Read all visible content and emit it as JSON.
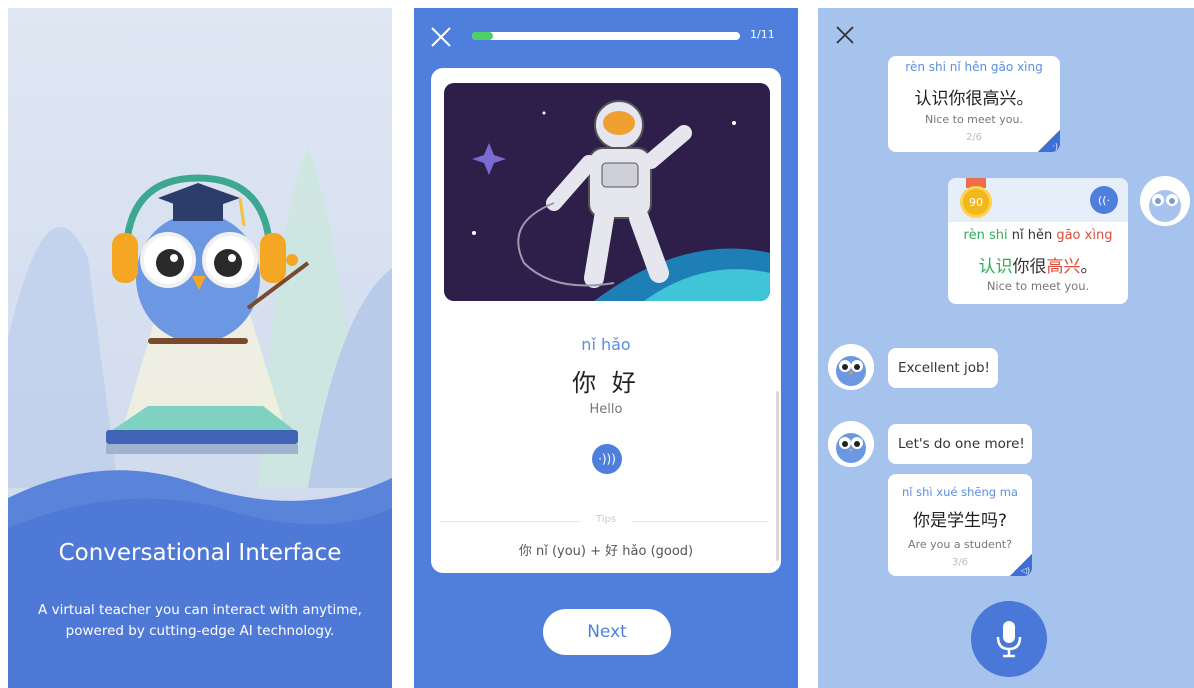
{
  "intro": {
    "title": "Conversational Interface",
    "description": "A virtual teacher you can interact with anytime, powered by cutting-edge AI technology."
  },
  "lesson": {
    "progress": 0.08,
    "counter": "1/11",
    "pinyin": "nǐ hǎo",
    "hanzi": "你 好",
    "english": "Hello",
    "tips_label": "Tips",
    "tips_text": "你 nǐ (you) + 好 hǎo (good)",
    "next_label": "Next",
    "colors": {
      "accent": "#4f7fdc",
      "progress": "#4cd16a"
    }
  },
  "chat": {
    "teacher_prompt_1": {
      "pinyin": "rèn shi nǐ hěn gāo xìng",
      "hanzi": "认识你很高兴。",
      "english": "Nice to meet you.",
      "count": "2/6"
    },
    "user_reply": {
      "score": "90",
      "segments": [
        {
          "pinyin": "rèn shi",
          "hanzi": "认识",
          "status": "correct"
        },
        {
          "pinyin": "nǐ hěn",
          "hanzi": "你很",
          "status": "neutral"
        },
        {
          "pinyin": "gāo xìng",
          "hanzi": "高兴",
          "status": "wrong"
        },
        {
          "pinyin": "",
          "hanzi": "。",
          "status": "neutral"
        }
      ],
      "english": "Nice to meet you."
    },
    "messages": [
      {
        "text": "Excellent job!"
      },
      {
        "text": "Let's do one more!"
      }
    ],
    "teacher_prompt_2": {
      "pinyin": "nǐ shì xué shēng ma",
      "hanzi": "你是学生吗?",
      "english": "Are you a student?",
      "count": "3/6"
    },
    "colors": {
      "correct": "#2fae5a",
      "wrong": "#e14b3b",
      "accent": "#4a78d8"
    }
  }
}
